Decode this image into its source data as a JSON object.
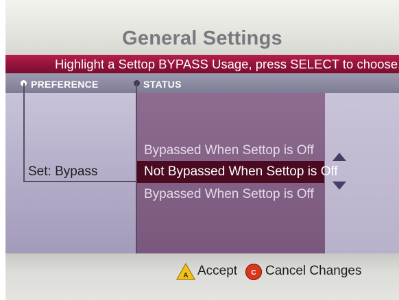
{
  "screen": {
    "title": "General Settings",
    "instruction": "Highlight a Settop BYPASS Usage, press SELECT to choose."
  },
  "columns": {
    "preference_label": "PREFERENCE",
    "status_label": "STATUS"
  },
  "preference": {
    "value": "Set: Bypass"
  },
  "status_options": [
    {
      "label": "Bypassed When Settop is Off",
      "selected": false
    },
    {
      "label": "Not Bypassed When Settop is Off",
      "selected": true
    },
    {
      "label": "Bypassed When Settop is Off",
      "selected": false
    }
  ],
  "footer": {
    "accept": {
      "key": "A",
      "label": "Accept",
      "icon": "yellow-triangle-a-icon"
    },
    "cancel": {
      "key": "C",
      "label": "Cancel Changes",
      "icon": "red-circle-c-icon"
    }
  },
  "colors": {
    "banner": "#8f1239",
    "selection": "#4a0a1f",
    "status_panel": "#7a587d",
    "title": "#77797e"
  }
}
